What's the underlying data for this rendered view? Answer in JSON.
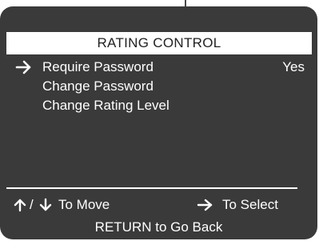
{
  "menu": {
    "title": "RATING CONTROL",
    "items": [
      {
        "label": "Require Password",
        "value": "Yes",
        "selected": true
      },
      {
        "label": "Change Password",
        "value": "",
        "selected": false
      },
      {
        "label": "Change Rating Level",
        "value": "",
        "selected": false
      }
    ]
  },
  "hints": {
    "slash": "/",
    "move_label": "To Move",
    "select_label": "To Select",
    "return_label": "RETURN to Go Back"
  },
  "icons": {
    "selection": "right-arrow-icon",
    "move_up": "up-arrow-icon",
    "move_down": "down-arrow-icon",
    "select": "right-arrow-icon"
  },
  "colors": {
    "panel": "#3a3a3a",
    "text": "#ffffff",
    "title_bar": "#ffffff",
    "title_text": "#222222"
  }
}
